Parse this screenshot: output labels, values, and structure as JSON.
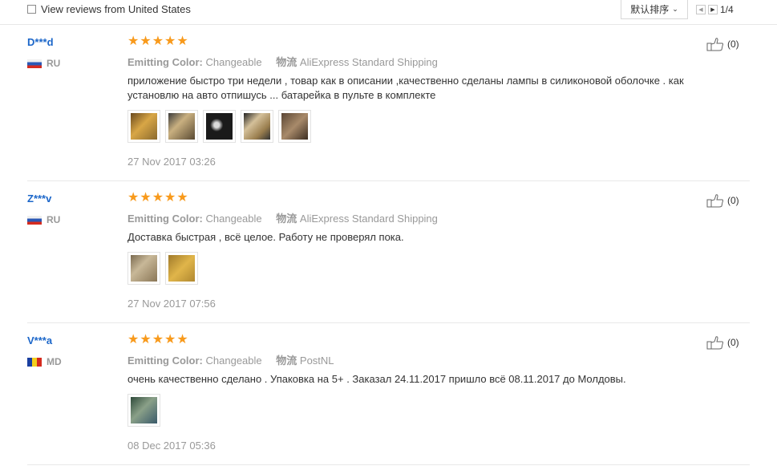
{
  "toolbar": {
    "filter_label": "View reviews from United States",
    "sort_label": "默认排序",
    "page_indicator": "1/4"
  },
  "reviews": [
    {
      "user": "D***d",
      "country": "RU",
      "rating": 5,
      "color_label": "Emitting Color:",
      "color_value": "Changeable",
      "shipping_label": "物流",
      "shipping_value": "AliExpress Standard Shipping",
      "text": "приложение быстро три недели , товар как в описании ,качественно сделаны лампы в силиконовой оболочке . как установлю на авто отпишусь ... батарейка в пульте в комплекте",
      "photo_count": 5,
      "date": "27 Nov 2017 03:26",
      "likes": "(0)"
    },
    {
      "user": "Z***v",
      "country": "RU",
      "rating": 5,
      "color_label": "Emitting Color:",
      "color_value": "Changeable",
      "shipping_label": "物流",
      "shipping_value": "AliExpress Standard Shipping",
      "text": "Доставка быстрая , всё целое. Работу не проверял пока.",
      "photo_count": 2,
      "date": "27 Nov 2017 07:56",
      "likes": "(0)"
    },
    {
      "user": "V***a",
      "country": "MD",
      "rating": 5,
      "color_label": "Emitting Color:",
      "color_value": "Changeable",
      "shipping_label": "物流",
      "shipping_value": "PostNL",
      "text": "очень качественно сделано . Упаковка на 5+ . Заказал 24.11.2017 пришло всё 08.11.2017 до Молдовы.",
      "photo_count": 1,
      "date": "08 Dec 2017 05:36",
      "likes": "(0)"
    }
  ],
  "colors": {
    "username": "#1b66c9",
    "star": "#f89a1c",
    "muted": "#999999"
  }
}
